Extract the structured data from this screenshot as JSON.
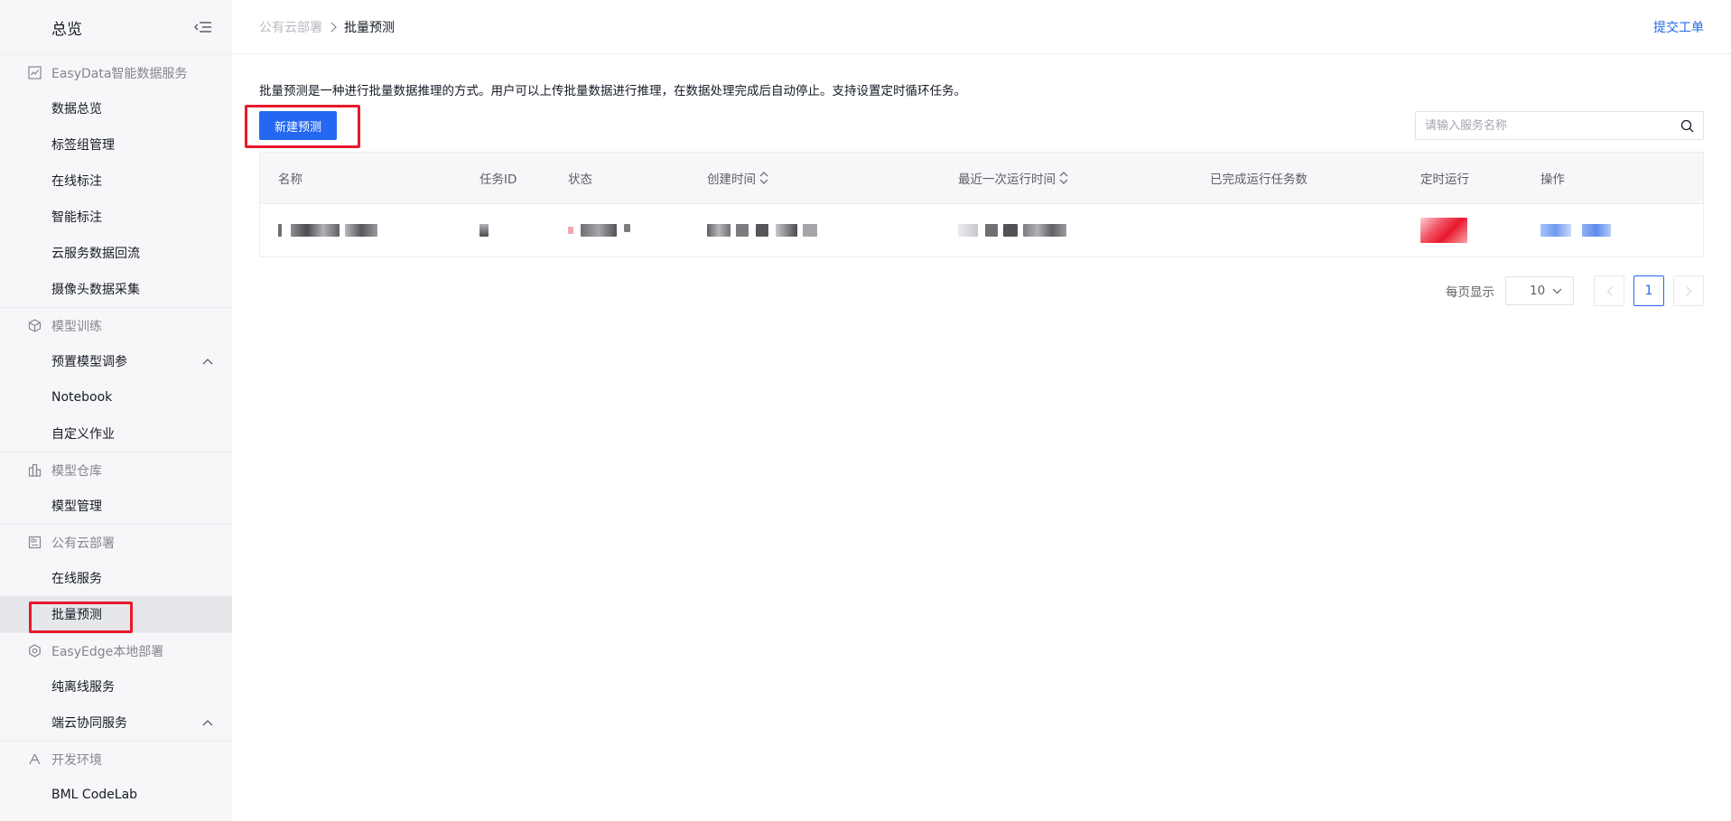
{
  "sidebar": {
    "title": "总览",
    "groups": [
      {
        "label": "EasyData智能数据服务",
        "icon": "chart-icon",
        "items": [
          {
            "label": "数据总览"
          },
          {
            "label": "标签组管理"
          },
          {
            "label": "在线标注"
          },
          {
            "label": "智能标注"
          },
          {
            "label": "云服务数据回流"
          },
          {
            "label": "摄像头数据采集"
          }
        ]
      },
      {
        "label": "模型训练",
        "icon": "cube-icon",
        "items": [
          {
            "label": "预置模型调参",
            "expandable": true
          },
          {
            "label": "Notebook"
          },
          {
            "label": "自定义作业"
          }
        ]
      },
      {
        "label": "模型仓库",
        "icon": "warehouse-icon",
        "items": [
          {
            "label": "模型管理"
          }
        ]
      },
      {
        "label": "公有云部署",
        "icon": "cloud-deploy-icon",
        "items": [
          {
            "label": "在线服务"
          },
          {
            "label": "批量预测",
            "active": true
          }
        ]
      },
      {
        "label": "EasyEdge本地部署",
        "icon": "hexagon-icon",
        "items": [
          {
            "label": "纯离线服务"
          },
          {
            "label": "端云协同服务",
            "expandable": true
          }
        ]
      },
      {
        "label": "开发环境",
        "icon": "triangle-nodes-icon",
        "items": [
          {
            "label": "BML CodeLab"
          }
        ]
      }
    ]
  },
  "header": {
    "breadcrumb_parent": "公有云部署",
    "breadcrumb_current": "批量预测",
    "ticket_link": "提交工单"
  },
  "main": {
    "description": "批量预测是一种进行批量数据推理的方式。用户可以上传批量数据进行推理，在数据处理完成后自动停止。支持设置定时循环任务。",
    "create_button": "新建预测",
    "search_placeholder": "请输入服务名称",
    "table": {
      "columns": [
        "名称",
        "任务ID",
        "状态",
        "创建时间",
        "最近一次运行时间",
        "已完成运行任务数",
        "定时运行",
        "操作"
      ]
    },
    "pagination": {
      "page_size_label": "每页显示",
      "page_size": "10",
      "current_page": "1"
    }
  },
  "colors": {
    "primary": "#2468f2",
    "highlight": "#e8192c",
    "sidebar_bg": "#f7f7f9"
  }
}
